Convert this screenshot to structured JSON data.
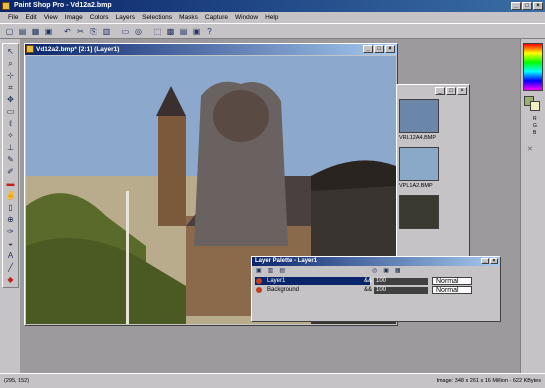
{
  "window": {
    "title": "Paint Shop Pro - Vd12a2.bmp",
    "minimize": "_",
    "maximize": "□",
    "close": "×"
  },
  "menu": [
    "File",
    "Edit",
    "View",
    "Image",
    "Colors",
    "Layers",
    "Selections",
    "Masks",
    "Capture",
    "Window",
    "Help"
  ],
  "toolbar": {
    "icons": [
      "new-file-icon",
      "open-icon",
      "save-icon",
      "print-icon",
      "undo-icon",
      "cut-icon",
      "copy-icon",
      "paste-icon",
      "browse-icon",
      "zoom-icon",
      "selection-icon",
      "palette-icon",
      "layer-icon",
      "overview-icon",
      "help-icon"
    ],
    "glyphs": [
      "▢",
      "▤",
      "▦",
      "▣",
      "↶",
      "✂",
      "⎘",
      "▥",
      "▭",
      "◎",
      "⬚",
      "▩",
      "▤",
      "▣",
      "?"
    ]
  },
  "tools": {
    "icons": [
      "arrow-icon",
      "zoom-icon",
      "deformation-icon",
      "crop-icon",
      "mover-icon",
      "selection-icon",
      "lasso-icon",
      "magic-wand-icon",
      "dropper-icon",
      "paintbrush-icon",
      "clone-brush-icon",
      "color-replacer-icon",
      "retouch-icon",
      "eraser-icon",
      "picture-tube-icon",
      "airbrush-icon",
      "flood-fill-icon",
      "text-icon",
      "line-icon",
      "shapes-icon"
    ],
    "glyphs": [
      "↖",
      "⌕",
      "⊹",
      "⌗",
      "✥",
      "▭",
      "ℓ",
      "✧",
      "⊥",
      "✎",
      "✐",
      "▬",
      "✌",
      "▯",
      "⊕",
      "✑",
      "◒",
      "A",
      "╱",
      "◆"
    ]
  },
  "document": {
    "title": "Vd12a2.bmp* [2:1] (Layer1)"
  },
  "thumbnails": {
    "items": [
      {
        "label": "VRL12A4.BMP",
        "color": "#6a86a8"
      },
      {
        "label": "VPL1A2.BMP",
        "color": "#8aa8c8"
      },
      {
        "label": "",
        "color": "#3a3a30"
      }
    ]
  },
  "layer_palette": {
    "title": "Layer Palette - Layer1",
    "layers": [
      {
        "name": "Layer1",
        "opacity": "&&",
        "selected": true
      },
      {
        "name": "Background",
        "opacity": "&&",
        "selected": false
      }
    ],
    "modes": [
      {
        "opacity": "100",
        "mode": "Normal"
      },
      {
        "opacity": "100",
        "mode": "Normal"
      }
    ]
  },
  "colors": {
    "foreground": "#9ab070",
    "background": "#f0f0c0",
    "readout": [
      "R",
      "G",
      "B"
    ]
  },
  "status": {
    "cursor": "(295, 152)",
    "image_info": "Image: 348 x 261 x 16 Million - 622 KBytes"
  }
}
